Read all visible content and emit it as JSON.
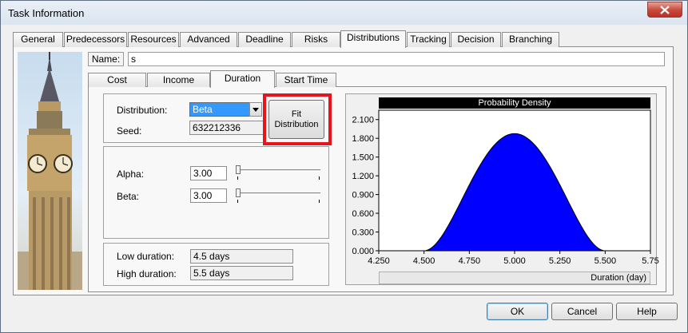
{
  "window": {
    "title": "Task Information"
  },
  "main_tabs": [
    {
      "label": "General"
    },
    {
      "label": "Predecessors"
    },
    {
      "label": "Resources"
    },
    {
      "label": "Advanced"
    },
    {
      "label": "Deadline"
    },
    {
      "label": "Risks"
    },
    {
      "label": "Distributions",
      "active": true
    },
    {
      "label": "Tracking"
    },
    {
      "label": "Decision"
    },
    {
      "label": "Branching"
    }
  ],
  "name": {
    "label": "Name:",
    "value": "s"
  },
  "sub_tabs": [
    {
      "label": "Cost"
    },
    {
      "label": "Income"
    },
    {
      "label": "Duration",
      "active": true
    },
    {
      "label": "Start Time"
    }
  ],
  "distribution": {
    "label": "Distribution:",
    "value": "Beta"
  },
  "seed": {
    "label": "Seed:",
    "value": "632212336"
  },
  "fit_button": {
    "line1": "Fit",
    "line2": "Distribution"
  },
  "alpha": {
    "label": "Alpha:",
    "value": "3.00"
  },
  "beta": {
    "label": "Beta:",
    "value": "3.00"
  },
  "low_duration": {
    "label": "Low duration:",
    "value": "4.5 days"
  },
  "high_duration": {
    "label": "High duration:",
    "value": "5.5 days"
  },
  "chart_data": {
    "type": "area",
    "title": "Probability Density",
    "xlabel": "Duration (day)",
    "ylabel": "",
    "x_ticks": [
      "4.250",
      "4.500",
      "4.750",
      "5.000",
      "5.250",
      "5.500",
      "5.75"
    ],
    "y_ticks": [
      "0.000",
      "0.300",
      "0.600",
      "0.900",
      "1.200",
      "1.500",
      "1.800",
      "2.100"
    ],
    "xlim": [
      4.25,
      5.75
    ],
    "ylim": [
      0,
      2.25
    ],
    "distribution": "beta",
    "alpha": 3.0,
    "beta": 3.0,
    "low": 4.5,
    "high": 5.5,
    "peak": {
      "x": 5.0,
      "y": 1.875
    },
    "fill_color": "#0000ff"
  },
  "buttons": {
    "ok": "OK",
    "cancel": "Cancel",
    "help": "Help"
  },
  "colors": {
    "highlight": "#e8141c",
    "selection": "#3399ff",
    "plot_fill": "#0000ff"
  }
}
